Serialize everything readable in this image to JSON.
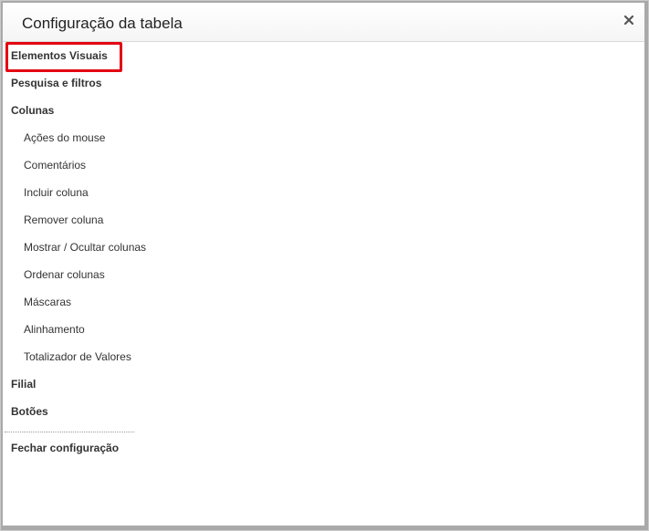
{
  "dialog": {
    "title": "Configuração da tabela"
  },
  "menu": {
    "items": [
      {
        "label": "Elementos Visuais"
      },
      {
        "label": "Pesquisa e filtros"
      },
      {
        "label": "Colunas"
      },
      {
        "label": "Ações do mouse"
      },
      {
        "label": "Comentários"
      },
      {
        "label": "Incluir coluna"
      },
      {
        "label": "Remover coluna"
      },
      {
        "label": "Mostrar / Ocultar colunas"
      },
      {
        "label": "Ordenar colunas"
      },
      {
        "label": "Máscaras"
      },
      {
        "label": "Alinhamento"
      },
      {
        "label": "Totalizador de Valores"
      },
      {
        "label": "Filial"
      },
      {
        "label": "Botões"
      }
    ],
    "close_config": "Fechar configuração"
  },
  "colors": {
    "highlight": "#e30613",
    "text": "#333333"
  },
  "icons": {
    "close": "close-icon"
  }
}
